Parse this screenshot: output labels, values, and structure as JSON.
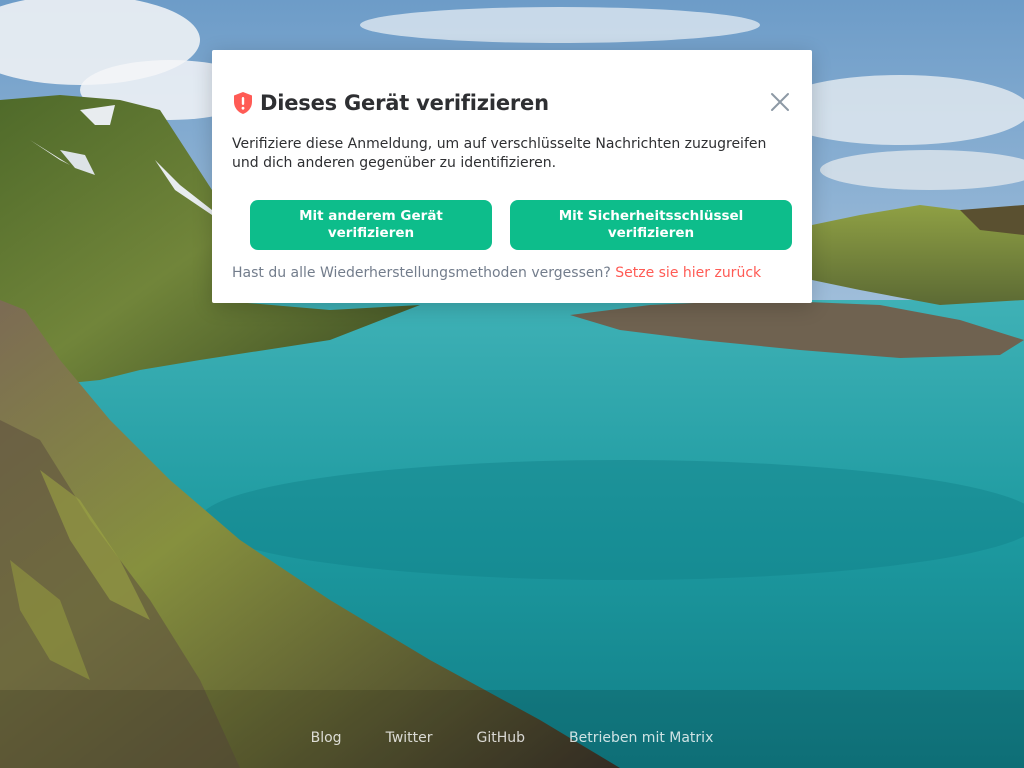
{
  "dialog": {
    "title": "Dieses Gerät verifizieren",
    "description": "Verifiziere diese Anmeldung, um auf verschlüsselte Nachrichten zuzugreifen und dich anderen gegenüber zu identifizieren.",
    "buttons": {
      "other_device": "Mit anderem Gerät verifizieren",
      "security_key": "Mit Sicherheitsschlüssel verifizieren"
    },
    "reset": {
      "question": "Hast du alle Wiederherstellungsmethoden vergessen?",
      "link": "Setze sie hier zurück"
    },
    "icons": {
      "title": "shield-warning-icon",
      "close": "close-icon"
    }
  },
  "footer": {
    "links": [
      "Blog",
      "Twitter",
      "GitHub",
      "Betrieben mit Matrix"
    ]
  },
  "colors": {
    "accent": "#0dbd8b",
    "alert": "#ff5b55",
    "text": "#2e2f32",
    "secondary_text": "#737d8c"
  },
  "background": {
    "description_icon": "landscape-background"
  }
}
